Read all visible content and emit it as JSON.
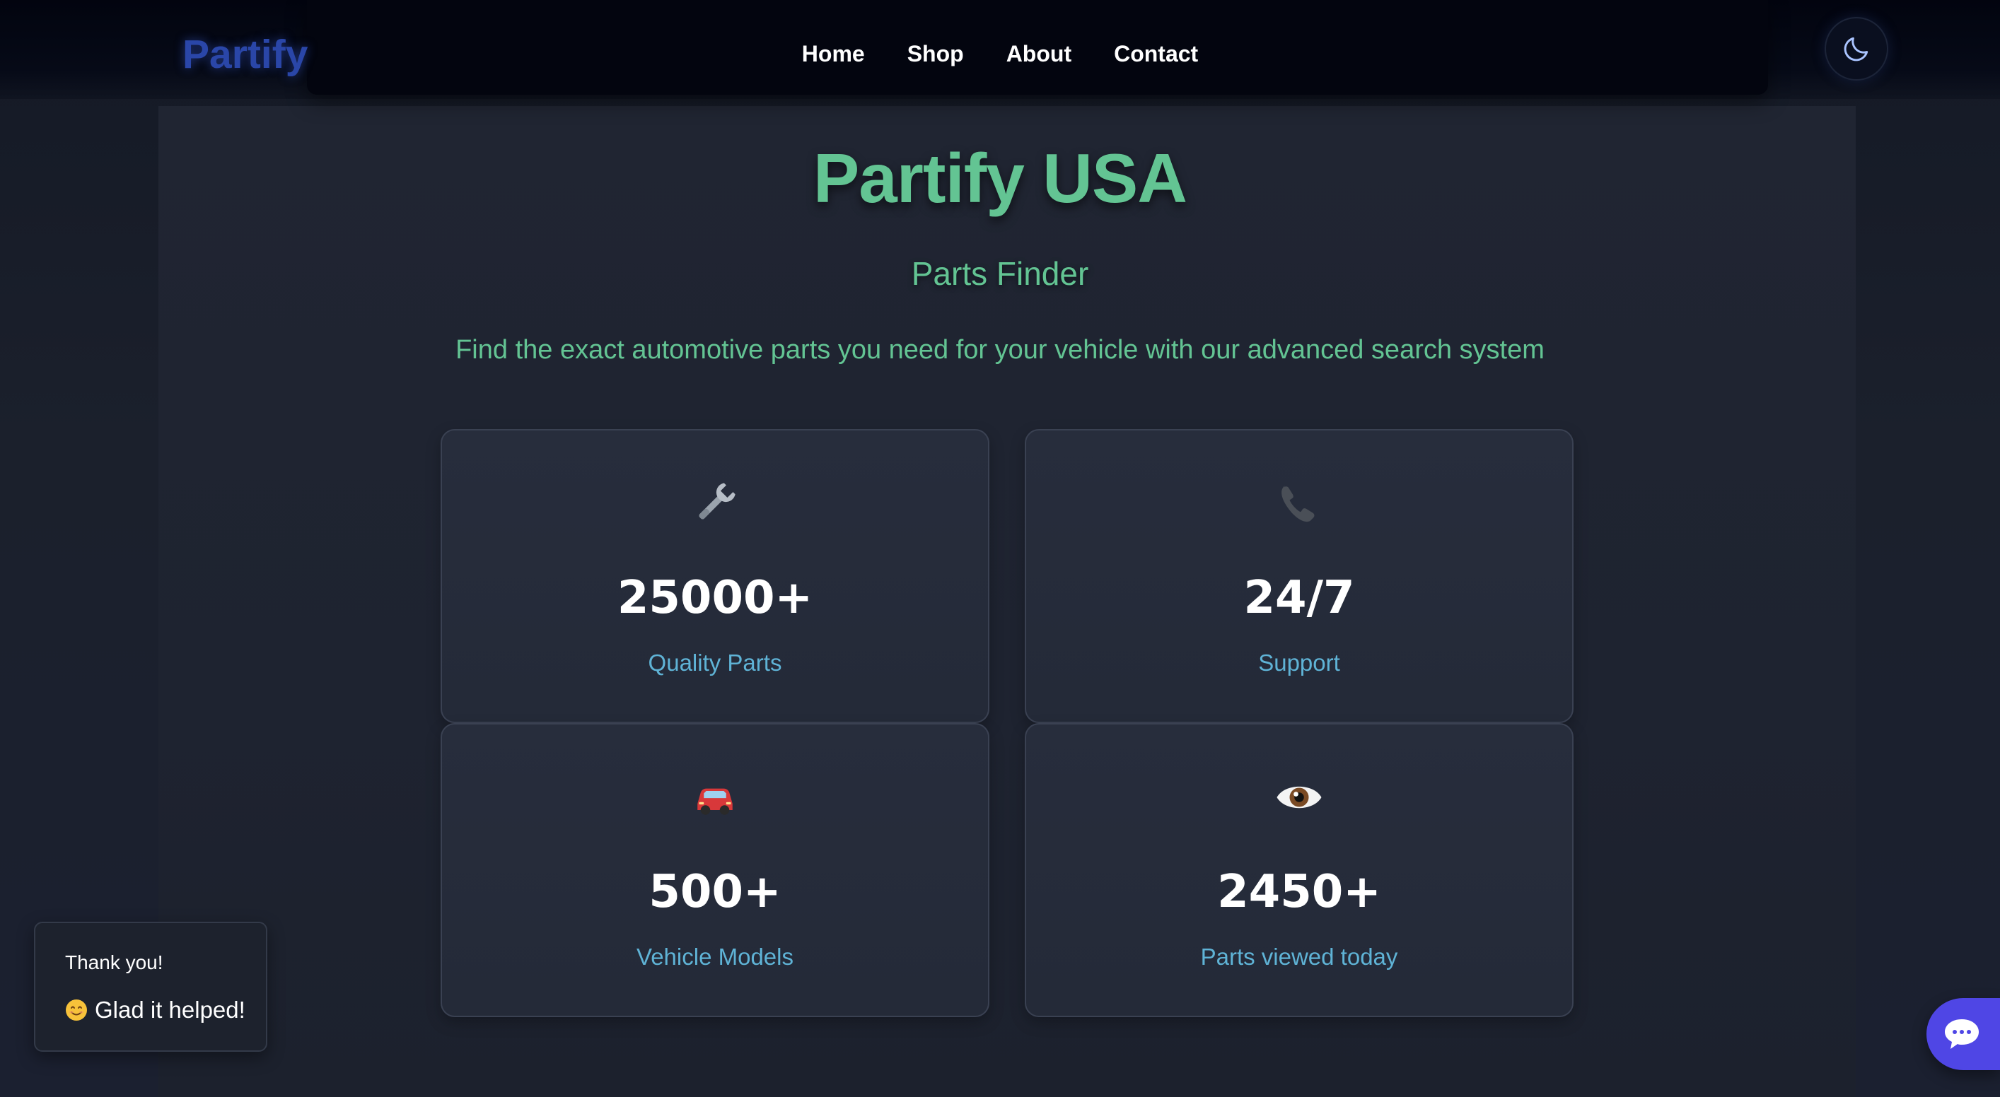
{
  "header": {
    "logo": "Partify",
    "nav": [
      {
        "label": "Home"
      },
      {
        "label": "Shop"
      },
      {
        "label": "About"
      },
      {
        "label": "Contact"
      }
    ],
    "theme_toggle_icon": "moon-icon"
  },
  "hero": {
    "title": "Partify USA",
    "subtitle": "Parts Finder",
    "description": "Find the exact automotive parts you need for your vehicle with our advanced search system"
  },
  "stats": [
    {
      "icon": "wrench-icon",
      "value": "25000+",
      "label": "Quality Parts"
    },
    {
      "icon": "phone-icon",
      "value": "24/7",
      "label": "Support"
    },
    {
      "icon": "car-icon",
      "value": "500+",
      "label": "Vehicle Models"
    },
    {
      "icon": "eye-icon",
      "value": "2450+",
      "label": "Parts viewed today"
    }
  ],
  "toast": {
    "title": "Thank you!",
    "message": "Glad it helped!",
    "message_icon": "smile-emoji-icon"
  },
  "chat": {
    "icon": "chat-bubble-icon"
  },
  "colors": {
    "accent_green": "#63c493",
    "logo_blue": "#2a46a8",
    "label_blue": "#5fb3d6",
    "chat_purple": "#4f46e5"
  }
}
